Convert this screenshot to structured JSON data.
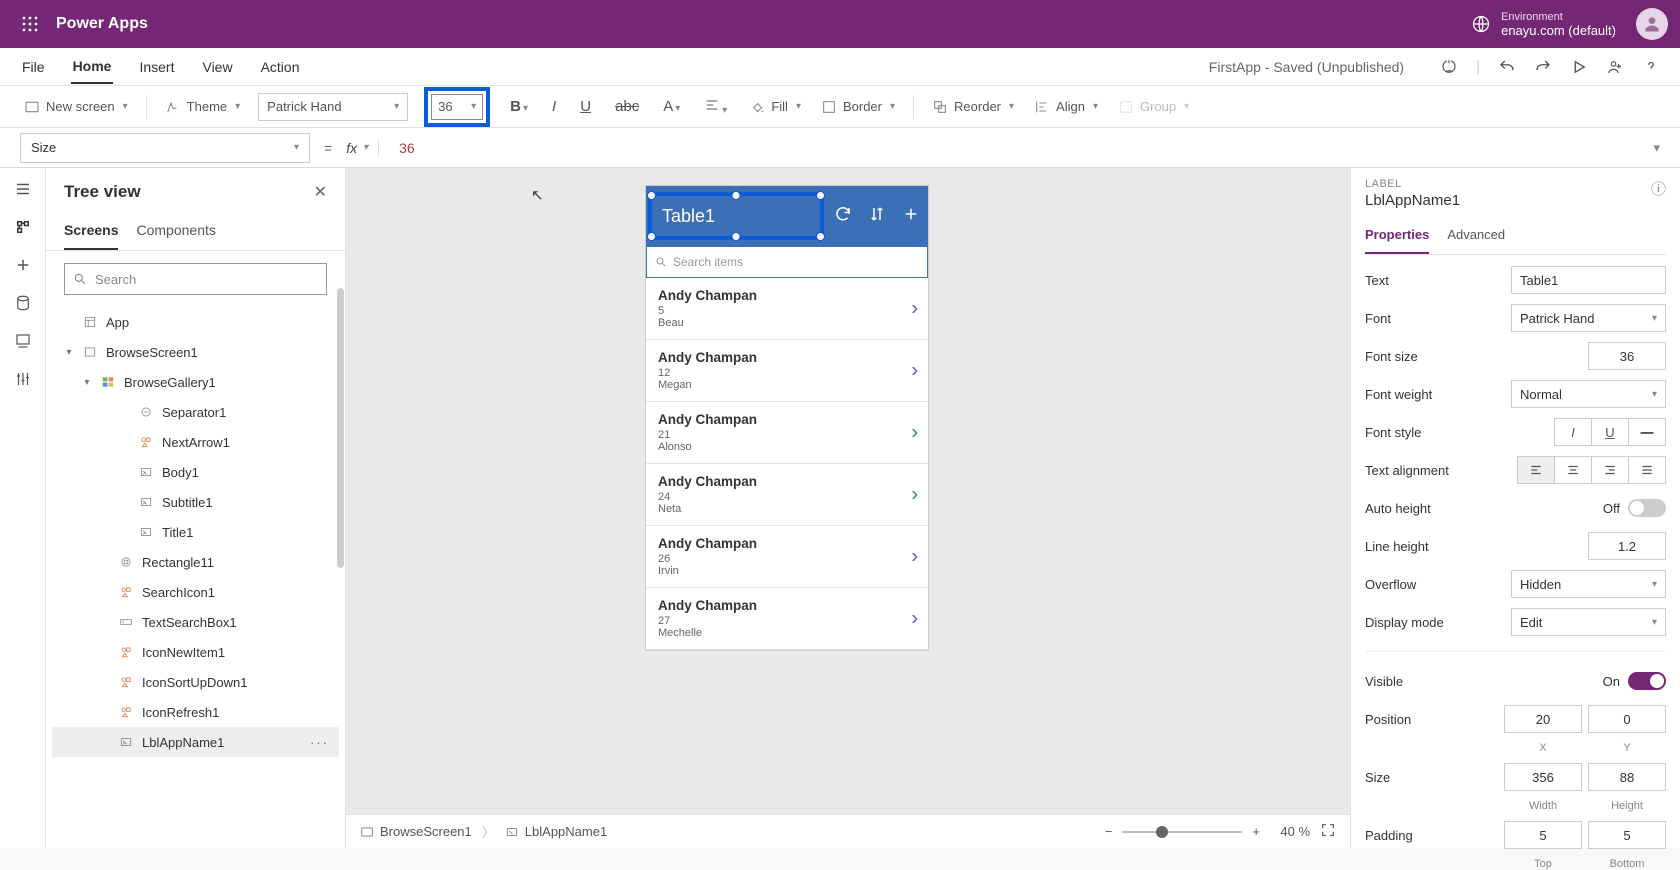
{
  "titlebar": {
    "app": "Power Apps",
    "env_label": "Environment",
    "env_value": "enayu.com (default)"
  },
  "menu": {
    "file": "File",
    "home": "Home",
    "insert": "Insert",
    "view": "View",
    "action": "Action",
    "status": "FirstApp - Saved (Unpublished)"
  },
  "ribbon": {
    "new_screen": "New screen",
    "theme": "Theme",
    "font": "Patrick Hand",
    "font_size": "36",
    "fill": "Fill",
    "border": "Border",
    "reorder": "Reorder",
    "align": "Align",
    "group": "Group"
  },
  "formula": {
    "property": "Size",
    "value": "36"
  },
  "tree": {
    "title": "Tree view",
    "tabs": {
      "screens": "Screens",
      "components": "Components"
    },
    "search_placeholder": "Search",
    "items": [
      {
        "label": "App",
        "indent": 1,
        "icon": "app"
      },
      {
        "label": "BrowseScreen1",
        "indent": 1,
        "icon": "screen",
        "twisty": "open"
      },
      {
        "label": "BrowseGallery1",
        "indent": 2,
        "icon": "gallery",
        "twisty": "open"
      },
      {
        "label": "Separator1",
        "indent": 4,
        "icon": "sep"
      },
      {
        "label": "NextArrow1",
        "indent": 4,
        "icon": "iconctl"
      },
      {
        "label": "Body1",
        "indent": 4,
        "icon": "label"
      },
      {
        "label": "Subtitle1",
        "indent": 4,
        "icon": "label"
      },
      {
        "label": "Title1",
        "indent": 4,
        "icon": "label"
      },
      {
        "label": "Rectangle11",
        "indent": 3,
        "icon": "rect"
      },
      {
        "label": "SearchIcon1",
        "indent": 3,
        "icon": "iconctl"
      },
      {
        "label": "TextSearchBox1",
        "indent": 3,
        "icon": "textinput"
      },
      {
        "label": "IconNewItem1",
        "indent": 3,
        "icon": "iconctl"
      },
      {
        "label": "IconSortUpDown1",
        "indent": 3,
        "icon": "iconctl"
      },
      {
        "label": "IconRefresh1",
        "indent": 3,
        "icon": "iconctl"
      },
      {
        "label": "LblAppName1",
        "indent": 3,
        "icon": "label",
        "selected": true
      }
    ]
  },
  "canvas": {
    "title_text": "Table1",
    "search_placeholder": "Search items",
    "rows": [
      {
        "title": "Andy Champan",
        "sub1": "5",
        "sub2": "Beau"
      },
      {
        "title": "Andy Champan",
        "sub1": "12",
        "sub2": "Megan"
      },
      {
        "title": "Andy Champan",
        "sub1": "21",
        "sub2": "Alonso"
      },
      {
        "title": "Andy Champan",
        "sub1": "24",
        "sub2": "Neta"
      },
      {
        "title": "Andy Champan",
        "sub1": "26",
        "sub2": "Irvin"
      },
      {
        "title": "Andy Champan",
        "sub1": "27",
        "sub2": "Mechelle"
      }
    ]
  },
  "footer": {
    "crumb1": "BrowseScreen1",
    "crumb2": "LblAppName1",
    "zoom_pct": "40",
    "zoom_unit": "%"
  },
  "props": {
    "type": "LABEL",
    "name": "LblAppName1",
    "tabs": {
      "properties": "Properties",
      "advanced": "Advanced"
    },
    "text_label": "Text",
    "text_value": "Table1",
    "font_label": "Font",
    "font_value": "Patrick Hand",
    "fontsize_label": "Font size",
    "fontsize_value": "36",
    "fontweight_label": "Font weight",
    "fontweight_value": "Normal",
    "fontstyle_label": "Font style",
    "textalign_label": "Text alignment",
    "autoheight_label": "Auto height",
    "autoheight_state": "Off",
    "lineheight_label": "Line height",
    "lineheight_value": "1.2",
    "overflow_label": "Overflow",
    "overflow_value": "Hidden",
    "displaymode_label": "Display mode",
    "displaymode_value": "Edit",
    "visible_label": "Visible",
    "visible_state": "On",
    "position_label": "Position",
    "position_x": "20",
    "position_y": "0",
    "x_lbl": "X",
    "y_lbl": "Y",
    "size_label": "Size",
    "size_w": "356",
    "size_h": "88",
    "w_lbl": "Width",
    "h_lbl": "Height",
    "padding_label": "Padding",
    "pad_t": "5",
    "pad_b": "5",
    "t_lbl": "Top",
    "b_lbl": "Bottom"
  }
}
